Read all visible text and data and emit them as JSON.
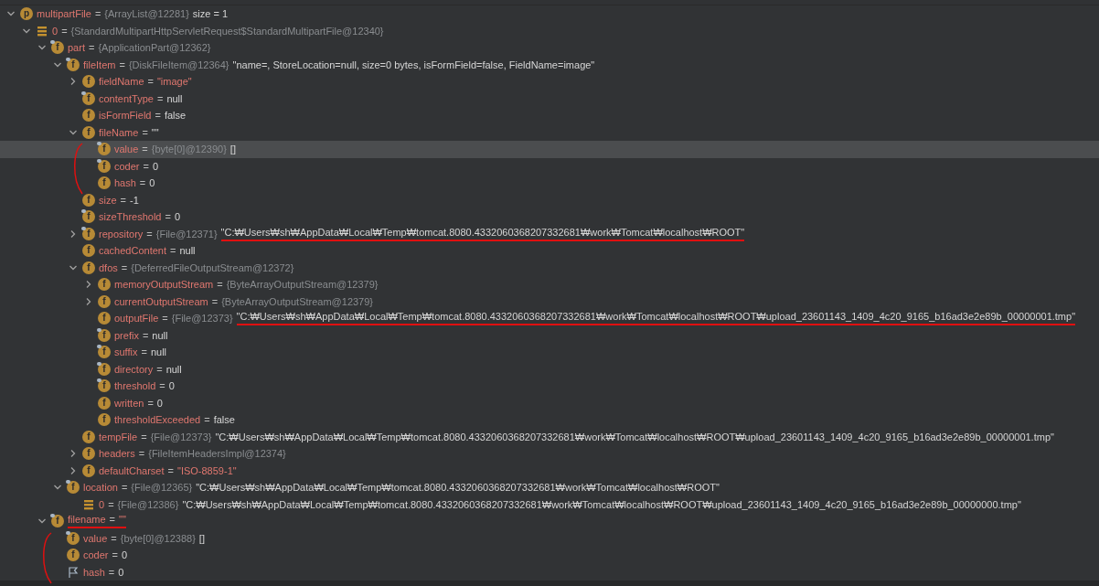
{
  "separator": "=",
  "variables": [
    {
      "kind": "param",
      "badge": "p",
      "locked": false,
      "name": "multipartFile",
      "type": "{ArrayList@12281}",
      "value": {
        "text": "size = 1",
        "kind": "plain"
      },
      "selected": false,
      "expanded": true,
      "children": [
        {
          "kind": "array",
          "name": "0",
          "type": "{StandardMultipartHttpServletRequest$StandardMultipartFile@12340}",
          "selected": false,
          "expanded": true,
          "children": [
            {
              "kind": "field",
              "badge": "f",
              "locked": true,
              "name": "part",
              "type": "{ApplicationPart@12362}",
              "selected": false,
              "expanded": true,
              "children": [
                {
                  "kind": "field",
                  "badge": "f",
                  "locked": true,
                  "name": "fileItem",
                  "type": "{DiskFileItem@12364}",
                  "value": {
                    "text": "\"name=, StoreLocation=null, size=0 bytes, isFormField=false, FieldName=image\"",
                    "kind": "plain"
                  },
                  "selected": false,
                  "expanded": true,
                  "children": [
                    {
                      "kind": "field",
                      "badge": "f",
                      "locked": false,
                      "name": "fieldName",
                      "value": {
                        "text": "\"image\"",
                        "kind": "string"
                      },
                      "selected": false,
                      "expanded": false
                    },
                    {
                      "kind": "field",
                      "badge": "f",
                      "locked": true,
                      "name": "contentType",
                      "value": {
                        "text": "null",
                        "kind": "plain"
                      },
                      "selected": false
                    },
                    {
                      "kind": "field",
                      "badge": "f",
                      "locked": false,
                      "name": "isFormField",
                      "value": {
                        "text": "false",
                        "kind": "plain"
                      },
                      "selected": false
                    },
                    {
                      "kind": "field",
                      "badge": "f",
                      "locked": false,
                      "name": "fileName",
                      "value": {
                        "text": "\"\"",
                        "kind": "plain"
                      },
                      "selected": false,
                      "expanded": true,
                      "bracket": true,
                      "children": [
                        {
                          "kind": "field",
                          "badge": "f",
                          "locked": true,
                          "name": "value",
                          "type": "{byte[0]@12390}",
                          "value": {
                            "text": "[]",
                            "kind": "plain"
                          },
                          "selected": true
                        },
                        {
                          "kind": "field",
                          "badge": "f",
                          "locked": true,
                          "name": "coder",
                          "value": {
                            "text": "0",
                            "kind": "plain"
                          },
                          "selected": false
                        },
                        {
                          "kind": "field",
                          "badge": "f",
                          "locked": false,
                          "name": "hash",
                          "value": {
                            "text": "0",
                            "kind": "plain"
                          },
                          "selected": false
                        }
                      ]
                    },
                    {
                      "kind": "field",
                      "badge": "f",
                      "locked": false,
                      "name": "size",
                      "value": {
                        "text": "-1",
                        "kind": "plain"
                      },
                      "selected": false
                    },
                    {
                      "kind": "field",
                      "badge": "f",
                      "locked": true,
                      "name": "sizeThreshold",
                      "value": {
                        "text": "0",
                        "kind": "plain"
                      },
                      "selected": false
                    },
                    {
                      "kind": "field",
                      "badge": "f",
                      "locked": true,
                      "name": "repository",
                      "type": "{File@12371}",
                      "value": {
                        "text": "\"C:₩Users₩sh₩AppData₩Local₩Temp₩tomcat.8080.4332060368207332681₩work₩Tomcat₩localhost₩ROOT\"",
                        "kind": "plain",
                        "underlined": true
                      },
                      "selected": false,
                      "expanded": false
                    },
                    {
                      "kind": "field",
                      "badge": "f",
                      "locked": false,
                      "name": "cachedContent",
                      "value": {
                        "text": "null",
                        "kind": "plain"
                      },
                      "selected": false
                    },
                    {
                      "kind": "field",
                      "badge": "f",
                      "locked": false,
                      "name": "dfos",
                      "type": "{DeferredFileOutputStream@12372}",
                      "selected": false,
                      "expanded": true,
                      "children": [
                        {
                          "kind": "field",
                          "badge": "f",
                          "locked": false,
                          "name": "memoryOutputStream",
                          "type": "{ByteArrayOutputStream@12379}",
                          "selected": false,
                          "expanded": false
                        },
                        {
                          "kind": "field",
                          "badge": "f",
                          "locked": false,
                          "name": "currentOutputStream",
                          "type": "{ByteArrayOutputStream@12379}",
                          "selected": false,
                          "expanded": false
                        },
                        {
                          "kind": "field",
                          "badge": "f",
                          "locked": false,
                          "name": "outputFile",
                          "type": "{File@12373}",
                          "value": {
                            "text": "\"C:₩Users₩sh₩AppData₩Local₩Temp₩tomcat.8080.4332060368207332681₩work₩Tomcat₩localhost₩ROOT₩upload_23601143_1409_4c20_9165_b16ad3e2e89b_00000001.tmp\"",
                            "kind": "plain",
                            "underlined": true
                          },
                          "selected": false
                        },
                        {
                          "kind": "field",
                          "badge": "f",
                          "locked": true,
                          "name": "prefix",
                          "value": {
                            "text": "null",
                            "kind": "plain"
                          },
                          "selected": false
                        },
                        {
                          "kind": "field",
                          "badge": "f",
                          "locked": true,
                          "name": "suffix",
                          "value": {
                            "text": "null",
                            "kind": "plain"
                          },
                          "selected": false
                        },
                        {
                          "kind": "field",
                          "badge": "f",
                          "locked": true,
                          "name": "directory",
                          "value": {
                            "text": "null",
                            "kind": "plain"
                          },
                          "selected": false
                        },
                        {
                          "kind": "field",
                          "badge": "f",
                          "locked": true,
                          "name": "threshold",
                          "value": {
                            "text": "0",
                            "kind": "plain"
                          },
                          "selected": false
                        },
                        {
                          "kind": "field",
                          "badge": "f",
                          "locked": false,
                          "name": "written",
                          "value": {
                            "text": "0",
                            "kind": "plain"
                          },
                          "selected": false
                        },
                        {
                          "kind": "field",
                          "badge": "f",
                          "locked": false,
                          "name": "thresholdExceeded",
                          "value": {
                            "text": "false",
                            "kind": "plain"
                          },
                          "selected": false
                        }
                      ]
                    },
                    {
                      "kind": "field",
                      "badge": "f",
                      "locked": false,
                      "name": "tempFile",
                      "type": "{File@12373}",
                      "value": {
                        "text": "\"C:₩Users₩sh₩AppData₩Local₩Temp₩tomcat.8080.4332060368207332681₩work₩Tomcat₩localhost₩ROOT₩upload_23601143_1409_4c20_9165_b16ad3e2e89b_00000001.tmp\"",
                        "kind": "plain"
                      },
                      "selected": false
                    },
                    {
                      "kind": "field",
                      "badge": "f",
                      "locked": false,
                      "name": "headers",
                      "type": "{FileItemHeadersImpl@12374}",
                      "selected": false,
                      "expanded": false
                    },
                    {
                      "kind": "field",
                      "badge": "f",
                      "locked": false,
                      "name": "defaultCharset",
                      "value": {
                        "text": "\"ISO-8859-1\"",
                        "kind": "string"
                      },
                      "selected": false,
                      "expanded": false
                    }
                  ]
                },
                {
                  "kind": "field",
                  "badge": "f",
                  "locked": true,
                  "name": "location",
                  "type": "{File@12365}",
                  "value": {
                    "text": "\"C:₩Users₩sh₩AppData₩Local₩Temp₩tomcat.8080.4332060368207332681₩work₩Tomcat₩localhost₩ROOT\"",
                    "kind": "plain"
                  },
                  "selected": false,
                  "expanded": true,
                  "children": [
                    {
                      "kind": "array",
                      "name": "0",
                      "type": "{File@12386}",
                      "value": {
                        "text": "\"C:₩Users₩sh₩AppData₩Local₩Temp₩tomcat.8080.4332060368207332681₩work₩Tomcat₩localhost₩ROOT₩upload_23601143_1409_4c20_9165_b16ad3e2e89b_00000000.tmp\"",
                        "kind": "plain"
                      },
                      "selected": false
                    }
                  ]
                }
              ]
            },
            {
              "kind": "field",
              "badge": "f",
              "locked": true,
              "name": "filename",
              "value": {
                "text": "\"\"",
                "kind": "string"
              },
              "selected": false,
              "expanded": true,
              "underlined": true,
              "bracket": true,
              "children": [
                {
                  "kind": "field",
                  "badge": "f",
                  "locked": true,
                  "name": "value",
                  "type": "{byte[0]@12388}",
                  "value": {
                    "text": "[]",
                    "kind": "plain"
                  },
                  "selected": false
                },
                {
                  "kind": "field",
                  "badge": "f",
                  "locked": false,
                  "name": "coder",
                  "value": {
                    "text": "0",
                    "kind": "plain"
                  },
                  "selected": false
                },
                {
                  "kind": "flag",
                  "name": "hash",
                  "value": {
                    "text": "0",
                    "kind": "plain"
                  },
                  "selected": false
                }
              ]
            }
          ]
        }
      ]
    }
  ]
}
